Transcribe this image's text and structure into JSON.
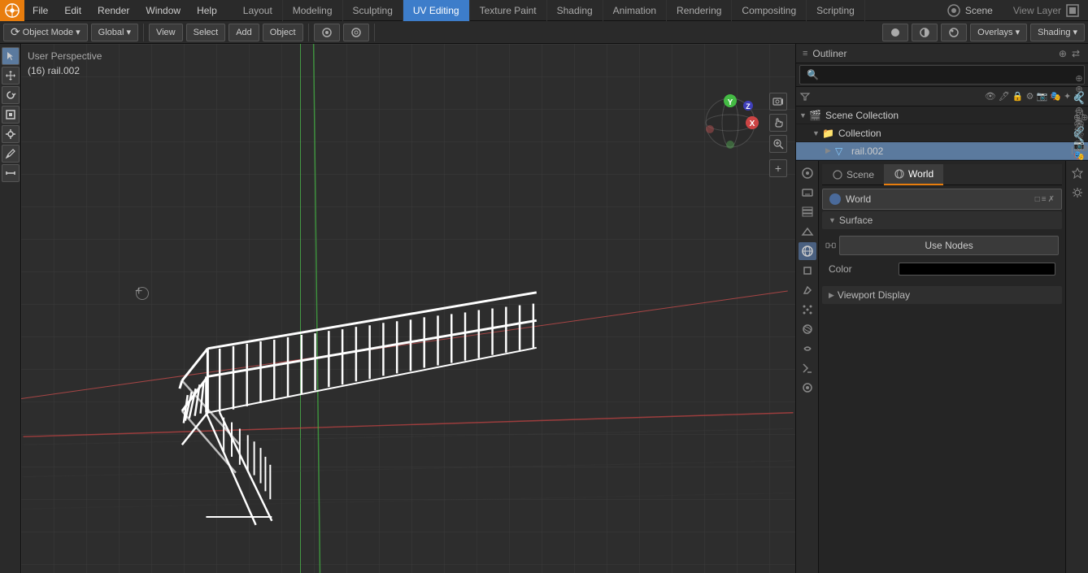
{
  "app": {
    "title": "Blender",
    "logo": "B"
  },
  "top_menu": {
    "items": [
      {
        "id": "blender",
        "label": ""
      },
      {
        "id": "file",
        "label": "File"
      },
      {
        "id": "edit",
        "label": "Edit"
      },
      {
        "id": "render",
        "label": "Render"
      },
      {
        "id": "window",
        "label": "Window"
      },
      {
        "id": "help",
        "label": "Help"
      }
    ]
  },
  "workspace_tabs": [
    {
      "id": "layout",
      "label": "Layout",
      "active": false
    },
    {
      "id": "modeling",
      "label": "Modeling",
      "active": false
    },
    {
      "id": "sculpting",
      "label": "Sculpting",
      "active": false
    },
    {
      "id": "uv_editing",
      "label": "UV Editing",
      "active": true
    },
    {
      "id": "texture_paint",
      "label": "Texture Paint",
      "active": false
    },
    {
      "id": "shading",
      "label": "Shading",
      "active": false
    },
    {
      "id": "animation",
      "label": "Animation",
      "active": false
    },
    {
      "id": "rendering",
      "label": "Rendering",
      "active": false
    },
    {
      "id": "compositing",
      "label": "Compositing",
      "active": false
    },
    {
      "id": "scripting",
      "label": "Scripting",
      "active": false
    }
  ],
  "top_right": {
    "scene_label": "Scene",
    "view_layer_label": "View Layer",
    "icons": [
      "grid",
      "camera",
      "world"
    ]
  },
  "toolbar2": {
    "mode_label": "Object Mode",
    "transform_label": "Global",
    "view_label": "View",
    "select_label": "Select",
    "add_label": "Add",
    "object_label": "Object",
    "overlays_label": "Overlays",
    "shading_label": "Shading"
  },
  "viewport": {
    "perspective_label": "User Perspective",
    "object_label": "(16) rail.002"
  },
  "outliner": {
    "title": "Outliner",
    "scene_collection_label": "Scene Collection",
    "collection_label": "Collection",
    "rail_label": "rail.002"
  },
  "right_tabs": [
    {
      "id": "scene",
      "label": "Scene",
      "active": false
    },
    {
      "id": "world",
      "label": "World",
      "active": true
    }
  ],
  "world": {
    "selector_label": "World",
    "surface_label": "Surface",
    "use_nodes_label": "Use Nodes",
    "color_label": "Color",
    "viewport_display_label": "Viewport Display"
  },
  "prop_icons": [
    {
      "id": "render",
      "icon": "📷",
      "label": "Render Properties"
    },
    {
      "id": "output",
      "icon": "🖨",
      "label": "Output Properties"
    },
    {
      "id": "view_layer",
      "icon": "🎞",
      "label": "View Layer"
    },
    {
      "id": "scene",
      "icon": "🎬",
      "label": "Scene"
    },
    {
      "id": "world",
      "icon": "🌍",
      "label": "World",
      "active": true
    },
    {
      "id": "object",
      "icon": "◻",
      "label": "Object"
    },
    {
      "id": "modifier",
      "icon": "🔧",
      "label": "Modifier"
    },
    {
      "id": "particles",
      "icon": "✦",
      "label": "Particles"
    },
    {
      "id": "physics",
      "icon": "⚛",
      "label": "Physics"
    },
    {
      "id": "constraints",
      "icon": "🔗",
      "label": "Constraints"
    },
    {
      "id": "data",
      "icon": "▽",
      "label": "Data"
    },
    {
      "id": "material",
      "icon": "◉",
      "label": "Material"
    }
  ]
}
